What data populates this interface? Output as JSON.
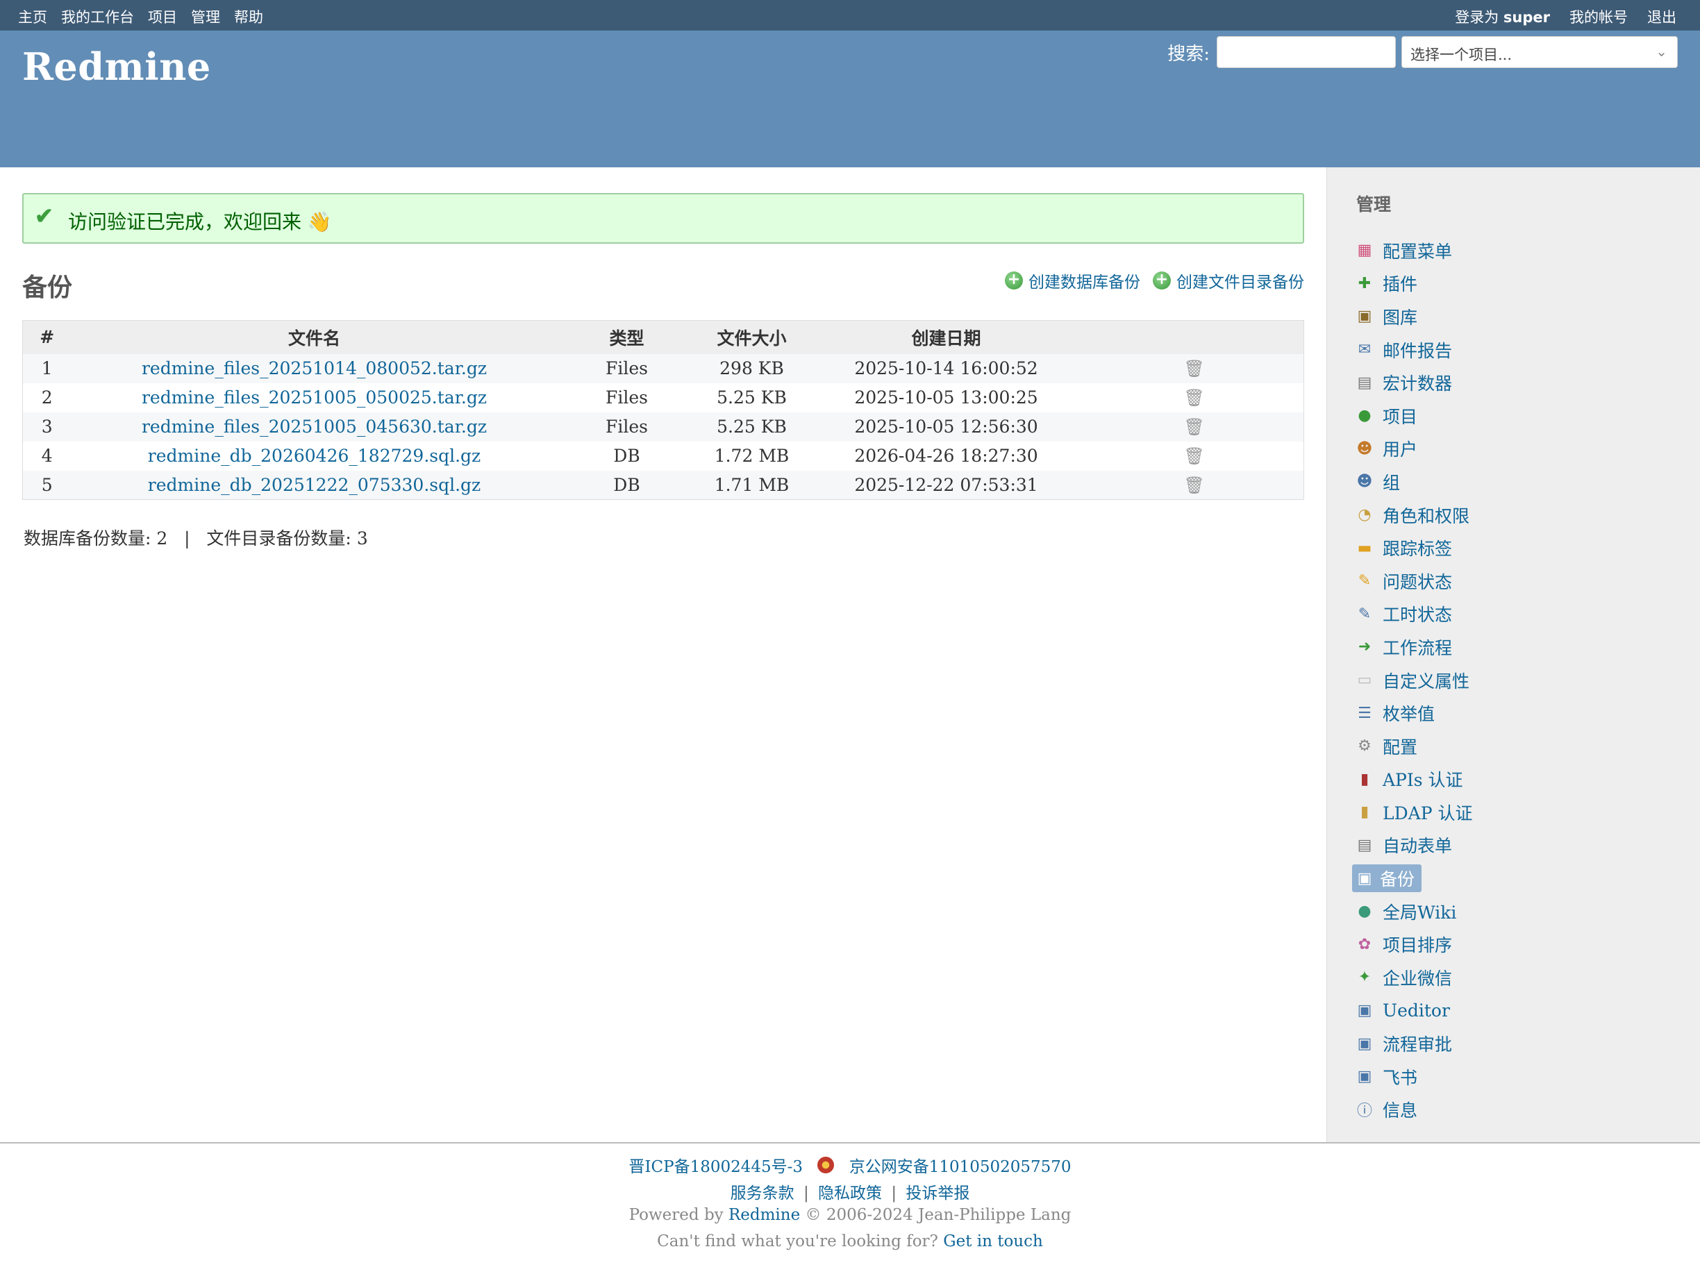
{
  "top_menu": {
    "left": [
      "主页",
      "我的工作台",
      "项目",
      "管理",
      "帮助"
    ],
    "logged_in_prefix": "登录为",
    "user": "super",
    "my_account": "我的帐号",
    "logout": "退出"
  },
  "header": {
    "title": "Redmine",
    "search_label": "搜索:",
    "search_value": "",
    "project_select": "选择一个项目..."
  },
  "flash": {
    "message": "访问验证已完成，欢迎回来 👋"
  },
  "page": {
    "title": "备份",
    "create_db_backup": "创建数据库备份",
    "create_files_backup": "创建文件目录备份"
  },
  "table": {
    "headers": [
      "#",
      "文件名",
      "类型",
      "文件大小",
      "创建日期",
      ""
    ],
    "rows": [
      {
        "n": "1",
        "file": "redmine_files_20251014_080052.tar.gz",
        "type": "Files",
        "size": "298 KB",
        "date": "2025-10-14 16:00:52"
      },
      {
        "n": "2",
        "file": "redmine_files_20251005_050025.tar.gz",
        "type": "Files",
        "size": "5.25 KB",
        "date": "2025-10-05 13:00:25"
      },
      {
        "n": "3",
        "file": "redmine_files_20251005_045630.tar.gz",
        "type": "Files",
        "size": "5.25 KB",
        "date": "2025-10-05 12:56:30"
      },
      {
        "n": "4",
        "file": "redmine_db_20260426_182729.sql.gz",
        "type": "DB",
        "size": "1.72 MB",
        "date": "2026-04-26 18:27:30"
      },
      {
        "n": "5",
        "file": "redmine_db_20251222_075330.sql.gz",
        "type": "DB",
        "size": "1.71 MB",
        "date": "2025-12-22 07:53:31"
      }
    ]
  },
  "counts": {
    "db_label": "数据库备份数量:",
    "db_count": "2",
    "sep": "|",
    "files_label": "文件目录备份数量:",
    "files_count": "3"
  },
  "sidebar": {
    "title": "管理",
    "items": [
      {
        "label": "配置菜单",
        "icon": "grid-icon",
        "glyph": "▦",
        "color": "#d04f7a"
      },
      {
        "label": "插件",
        "icon": "puzzle-icon",
        "glyph": "✚",
        "color": "#3a9a3a"
      },
      {
        "label": "图库",
        "icon": "gallery-icon",
        "glyph": "▣",
        "color": "#8a6a2a"
      },
      {
        "label": "邮件报告",
        "icon": "mail-icon",
        "glyph": "✉",
        "color": "#4a76a8"
      },
      {
        "label": "宏计数器",
        "icon": "calculator-icon",
        "glyph": "▤",
        "color": "#777"
      },
      {
        "label": "项目",
        "icon": "projects-icon",
        "glyph": "●",
        "color": "#3a9a3a"
      },
      {
        "label": "用户",
        "icon": "user-icon",
        "glyph": "☻",
        "color": "#c47a2a"
      },
      {
        "label": "组",
        "icon": "group-icon",
        "glyph": "☻",
        "color": "#4a76a8"
      },
      {
        "label": "角色和权限",
        "icon": "roles-icon",
        "glyph": "◔",
        "color": "#c8a040"
      },
      {
        "label": "跟踪标签",
        "icon": "tracker-icon",
        "glyph": "▬",
        "color": "#e0a020"
      },
      {
        "label": "问题状态",
        "icon": "issue-status-icon",
        "glyph": "✎",
        "color": "#e0a020"
      },
      {
        "label": "工时状态",
        "icon": "time-status-icon",
        "glyph": "✎",
        "color": "#4a76a8"
      },
      {
        "label": "工作流程",
        "icon": "workflow-icon",
        "glyph": "➜",
        "color": "#3a9a3a"
      },
      {
        "label": "自定义属性",
        "icon": "custom-field-icon",
        "glyph": "▭",
        "color": "#bbb"
      },
      {
        "label": "枚举值",
        "icon": "list-icon",
        "glyph": "☰",
        "color": "#4a76a8"
      },
      {
        "label": "配置",
        "icon": "gear-icon",
        "glyph": "⚙",
        "color": "#888"
      },
      {
        "label": "APIs 认证",
        "icon": "api-auth-icon",
        "glyph": "▮",
        "color": "#a33"
      },
      {
        "label": "LDAP 认证",
        "icon": "ldap-auth-icon",
        "glyph": "▮",
        "color": "#c8a040"
      },
      {
        "label": "自动表单",
        "icon": "form-icon",
        "glyph": "▤",
        "color": "#777"
      },
      {
        "label": "备份",
        "icon": "backup-icon",
        "glyph": "▣",
        "color": "#fff",
        "selected": true
      },
      {
        "label": "全局Wiki",
        "icon": "globe-icon",
        "glyph": "●",
        "color": "#3a9a7a"
      },
      {
        "label": "项目排序",
        "icon": "project-sort-icon",
        "glyph": "✿",
        "color": "#c060a0"
      },
      {
        "label": "企业微信",
        "icon": "wecom-icon",
        "glyph": "✦",
        "color": "#3a9a3a"
      },
      {
        "label": "Ueditor",
        "icon": "editor-icon",
        "glyph": "▣",
        "color": "#4a76a8"
      },
      {
        "label": "流程审批",
        "icon": "approval-icon",
        "glyph": "▣",
        "color": "#4a76a8"
      },
      {
        "label": "飞书",
        "icon": "feishu-icon",
        "glyph": "▣",
        "color": "#4a76a8"
      },
      {
        "label": "信息",
        "icon": "info-icon",
        "glyph": "ⓘ",
        "color": "#4a76a8"
      }
    ]
  },
  "footer": {
    "icp": "晋ICP备18002445号-3",
    "police": "京公网安备11010502057570",
    "links": [
      "服务条款",
      "隐私政策",
      "投诉举报"
    ],
    "link_sep": "|",
    "powered_prefix": "Powered by",
    "powered_link": "Redmine",
    "powered_suffix": "© 2006-2024 Jean-Philippe Lang",
    "help_prefix": "Can't find what you're looking for?",
    "help_link": "Get in touch"
  },
  "colors": {
    "top_menu_bg": "#3e5b76",
    "header_bg": "#628db6",
    "link": "#169",
    "flash_bg": "#dfffdf",
    "sidebar_bg": "#eeeeee"
  }
}
